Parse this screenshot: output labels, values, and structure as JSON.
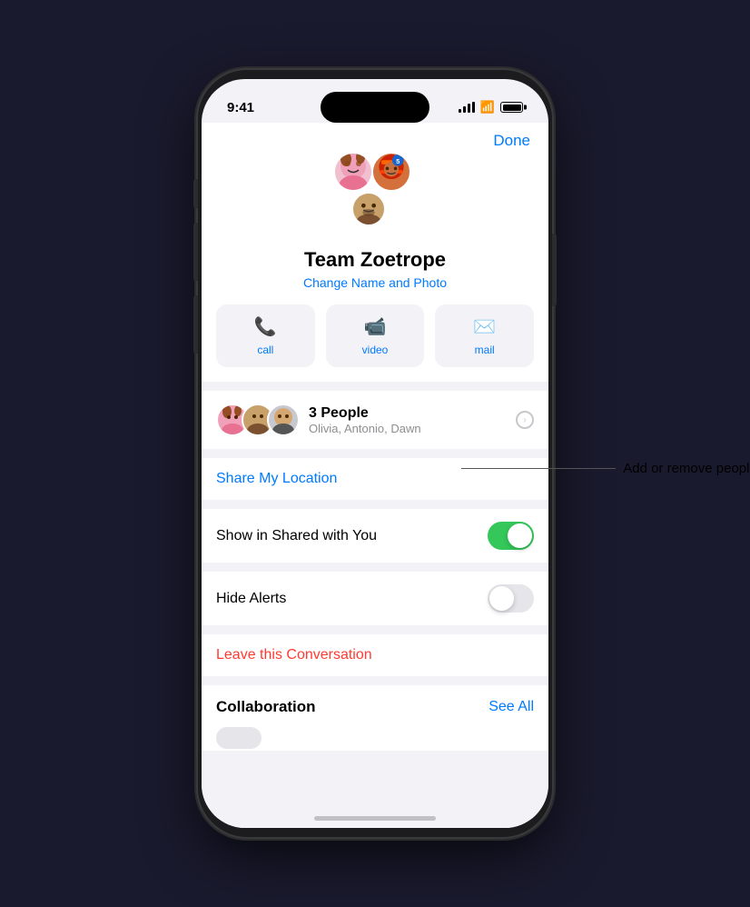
{
  "status_bar": {
    "time": "9:41",
    "signal_bars": [
      4,
      7,
      10,
      12
    ],
    "battery_level": "full"
  },
  "header": {
    "done_label": "Done"
  },
  "group": {
    "name": "Team Zoetrope",
    "change_name_label": "Change Name and Photo"
  },
  "actions": [
    {
      "id": "call",
      "label": "call",
      "icon": "📞"
    },
    {
      "id": "video",
      "label": "video",
      "icon": "📹"
    },
    {
      "id": "mail",
      "label": "mail",
      "icon": "✉️"
    }
  ],
  "people_section": {
    "count_label": "3 People",
    "names": "Olivia, Antonio, Dawn"
  },
  "share_location": {
    "label": "Share My Location"
  },
  "shared_with_you": {
    "label": "Show in Shared with You",
    "toggle_state": "on"
  },
  "hide_alerts": {
    "label": "Hide Alerts",
    "toggle_state": "off"
  },
  "leave_conversation": {
    "label": "Leave this Conversation"
  },
  "collaboration": {
    "title": "Collaboration",
    "see_all_label": "See All"
  },
  "annotation": {
    "text": "Add or remove people."
  }
}
